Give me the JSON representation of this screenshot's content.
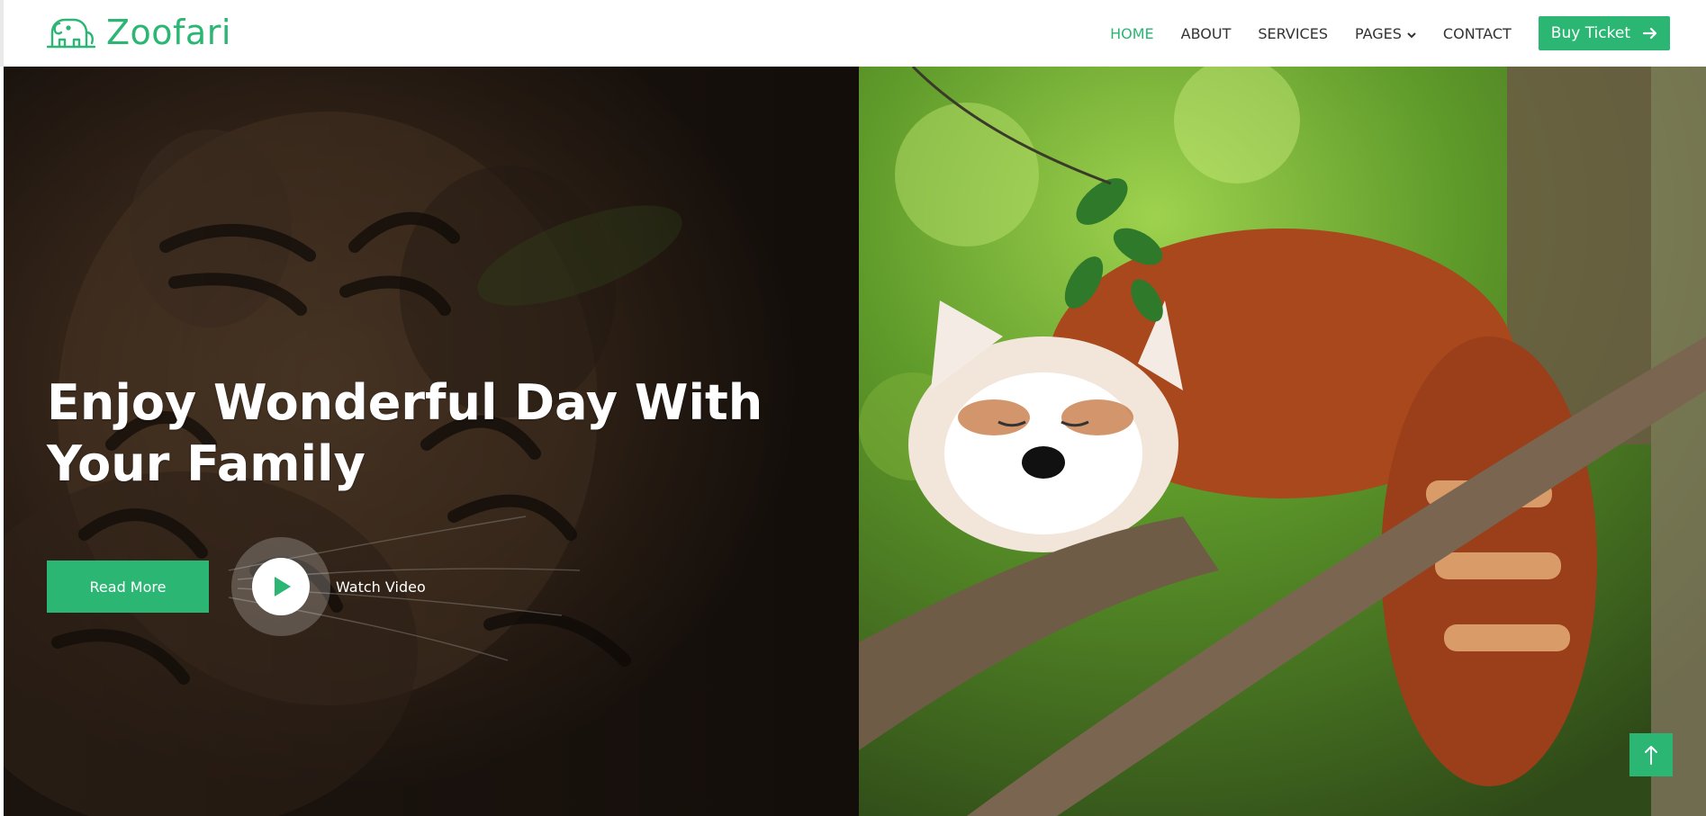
{
  "brand": {
    "name": "Zoofari",
    "icon": "elephant-icon",
    "color": "#2bb673"
  },
  "nav": {
    "items": [
      {
        "label": "HOME",
        "active": true
      },
      {
        "label": "ABOUT",
        "active": false
      },
      {
        "label": "SERVICES",
        "active": false
      },
      {
        "label": "PAGES",
        "active": false,
        "dropdown": true
      },
      {
        "label": "CONTACT",
        "active": false
      }
    ],
    "cta_label": "Buy Ticket",
    "cta_icon": "arrow-right-icon"
  },
  "hero": {
    "title": "Enjoy Wonderful Day With Your Family",
    "read_more_label": "Read More",
    "watch_label": "Watch Video",
    "left_image": "tiger-photo",
    "right_image": "red-panda-photo"
  },
  "back_to_top_icon": "arrow-up-icon",
  "colors": {
    "accent": "#2bb673",
    "nav_text": "#333333",
    "white": "#ffffff"
  }
}
